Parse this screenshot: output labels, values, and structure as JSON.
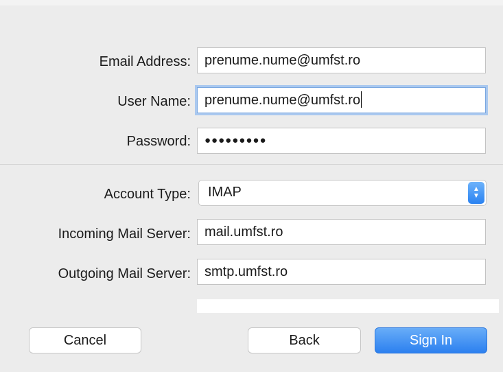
{
  "form": {
    "email_label": "Email Address:",
    "email_value": "prenume.nume@umfst.ro",
    "username_label": "User Name:",
    "username_value": "prenume.nume@umfst.ro",
    "password_label": "Password:",
    "password_value": "●●●●●●●●●",
    "account_type_label": "Account Type:",
    "account_type_value": "IMAP",
    "incoming_label": "Incoming Mail Server:",
    "incoming_value": "mail.umfst.ro",
    "outgoing_label": "Outgoing Mail Server:",
    "outgoing_value": "smtp.umfst.ro"
  },
  "buttons": {
    "cancel": "Cancel",
    "back": "Back",
    "sign_in": "Sign In"
  },
  "icons": {
    "select_stepper": "up-down-chevron-icon"
  },
  "colors": {
    "accent": "#2c80ef",
    "focus_ring": "#a9c8ef",
    "window_bg": "#ececec"
  }
}
